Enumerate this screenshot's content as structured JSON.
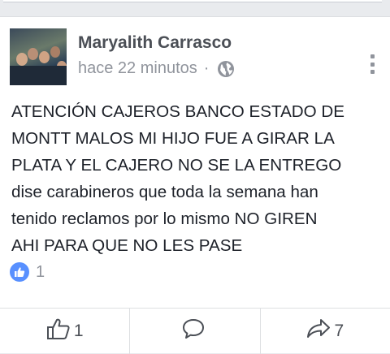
{
  "post": {
    "author": "Maryalith Carrasco",
    "timestamp": "hace 22 minutos",
    "separator": "·",
    "privacy_icon": "globe-icon",
    "options_icon": "vertical-dots-icon",
    "text": "ATENCIÓN CAJEROS BANCO ESTADO DE\nMONTT MALOS MI HIJO FUE A GIRAR LA\nPLATA Y EL CAJERO  NO SE LA ENTREGO\ndise carabineros que toda la semana han\ntenido reclamos por lo mismo NO GIREN\nAHI PARA QUE NO LES PASE"
  },
  "reactions": {
    "icon": "like-reaction-icon",
    "count": "1",
    "color": "#5890ff"
  },
  "actions": {
    "like": {
      "icon": "thumbs-up-icon",
      "count": "1"
    },
    "comment": {
      "icon": "comment-icon",
      "count": ""
    },
    "share": {
      "icon": "share-arrow-icon",
      "count": "7"
    }
  }
}
